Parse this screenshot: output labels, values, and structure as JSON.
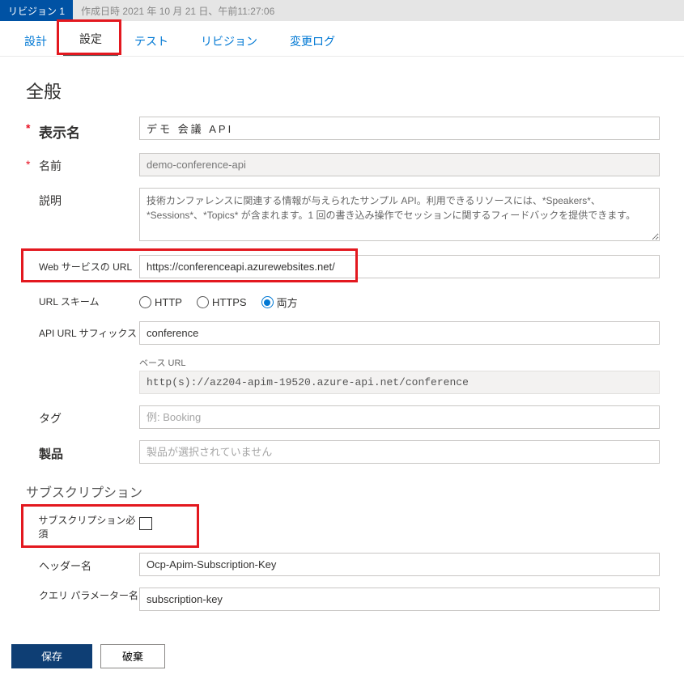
{
  "revision": {
    "badge": "リビジョン 1",
    "created_label": "作成日時",
    "date": "2021 年 10 月 21 日、午前11:27:06"
  },
  "tabs": {
    "design": "設計",
    "settings": "設定",
    "test": "テスト",
    "revisions": "リビジョン",
    "changelog": "変更ログ"
  },
  "section": {
    "general": "全般",
    "subscription": "サブスクリプション"
  },
  "labels": {
    "display_name": "表示名",
    "name": "名前",
    "description": "説明",
    "web_service_url": "Web サービスの URL",
    "url_scheme": "URL スキーム",
    "api_url_suffix": "API URL サフィックス",
    "base_url": "ベース URL",
    "tags": "タグ",
    "products": "製品",
    "subscription_required": "サブスクリプション必須",
    "header_name": "ヘッダー名",
    "query_param_name": "クエリ パラメーター名"
  },
  "values": {
    "display_name": "デモ 会議 API",
    "name": "demo-conference-api",
    "description": "技術カンファレンスに関連する情報が与えられたサンプル API。利用できるリソースには、*Speakers*、*Sessions*、*Topics* が含まれます。1 回の書き込み操作でセッションに関するフィードバックを提供できます。",
    "web_service_url": "https://conferenceapi.azurewebsites.net/",
    "scheme_http": "HTTP",
    "scheme_https": "HTTPS",
    "scheme_both": "両方",
    "api_url_suffix": "conference",
    "base_url": "http(s)://az204-apim-19520.azure-api.net/conference",
    "tags_placeholder": "例: Booking",
    "products_placeholder": "製品が選択されていません",
    "header_name": "Ocp-Apim-Subscription-Key",
    "query_param_name": "subscription-key"
  },
  "buttons": {
    "save": "保存",
    "discard": "破棄"
  }
}
